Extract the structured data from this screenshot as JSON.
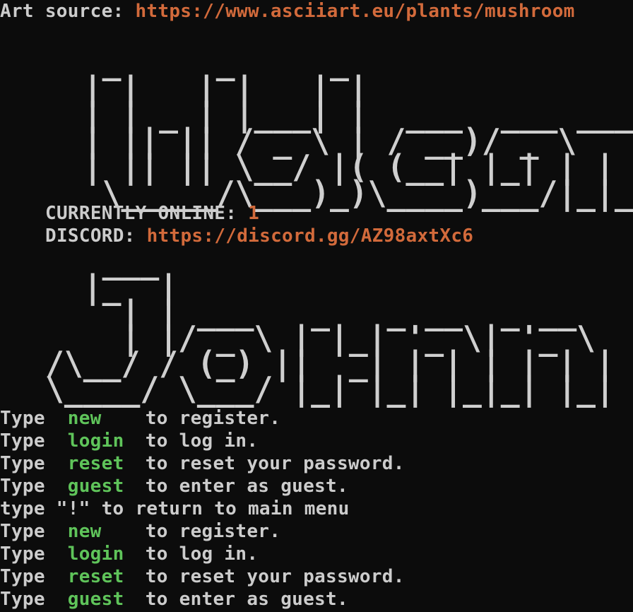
{
  "art_source": {
    "label": "Art source: ",
    "url": "https://www.asciiart.eu/plants/mushroom"
  },
  "banner_welcome": [
    "   _     _     _                      _",
    "  | |   | |   | |                    | |",
    "  | | _ | |___| |  ___  ___ ____  ___| |_  ___",
    "  | || || / _ \\ | / __)/ _ \\    \\/ _ \\  _)/ _ \\",
    "  | || || \\__/ |( (__| |_| | | | \\__/ |_| |_| |",
    "   \\_____/\\___)_)\\____)___/|_|_|_\\___)\\__)___/"
  ],
  "status": {
    "online_label": "CURRENTLY ONLINE: ",
    "online_count": "1",
    "discord_label": "DISCORD: ",
    "discord_url": "https://discord.gg/AZ98axtXc6"
  },
  "banner_name": [
    "   ___",
    "  |_  |",
    "    | | ___   _   _ __  _ __     _._.  _._",
    "    | |/ _ \\ | |_| '_ \\| '_ \\  (-)(-)  .-'.",
    "/\\__/ / (_) ||  _| | | | | | |  `~  |  ;_) .|",
    "\\____/ \\___/ |_| |_| |_|_| |_|   )__\\______/"
  ],
  "menu_prefix": "Type",
  "menu": [
    {
      "cmd": "new",
      "text": "to register."
    },
    {
      "cmd": "login",
      "text": "to log in."
    },
    {
      "cmd": "reset",
      "text": "to reset your password."
    },
    {
      "cmd": "guest",
      "text": "to enter as guest."
    }
  ],
  "return_hint": "type \"!\" to return to main menu",
  "menu_repeat": [
    {
      "cmd": "new",
      "text": "to register."
    },
    {
      "cmd": "login",
      "text": "to log in."
    },
    {
      "cmd": "reset",
      "text": "to reset your password."
    },
    {
      "cmd": "guest",
      "text": "to enter as guest."
    }
  ],
  "colors": {
    "background": "#0c0c0c",
    "text": "#cccccc",
    "url": "#d26a3b",
    "command": "#5fc45a"
  }
}
